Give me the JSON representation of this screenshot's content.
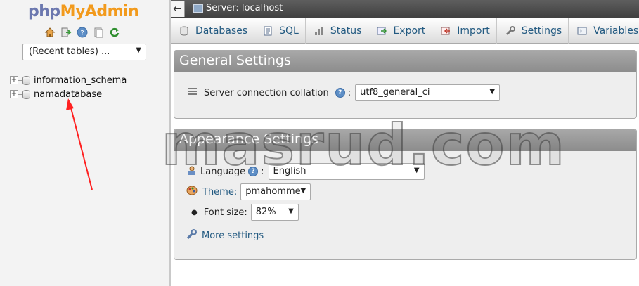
{
  "nav": {
    "logo_part1": "php",
    "logo_part2": "MyAdmin",
    "quick_icons": [
      "home-icon",
      "logout-icon",
      "help-icon",
      "documentation-icon",
      "reload-icon"
    ],
    "recent_tables": "(Recent tables) ...",
    "databases": [
      {
        "name": "information_schema",
        "expander": "+"
      },
      {
        "name": "namadatabase",
        "expander": "+"
      }
    ]
  },
  "topbar": {
    "back": "←",
    "title": "Server: localhost"
  },
  "tabs": [
    {
      "label": "Databases",
      "icon": "database-icon"
    },
    {
      "label": "SQL",
      "icon": "sql-icon"
    },
    {
      "label": "Status",
      "icon": "status-icon"
    },
    {
      "label": "Export",
      "icon": "export-icon"
    },
    {
      "label": "Import",
      "icon": "import-icon"
    },
    {
      "label": "Settings",
      "icon": "wrench-icon"
    },
    {
      "label": "Variables",
      "icon": "variables-icon"
    }
  ],
  "general": {
    "legend": "General Settings",
    "collation_label": "Server connection collation",
    "colon": ":",
    "collation_value": "utf8_general_ci"
  },
  "appearance": {
    "legend": "Appearance Settings",
    "language_label": "Language",
    "language_value": "English",
    "theme_label": "Theme:",
    "theme_value": "pmahomme",
    "fontsize_label": "Font size:",
    "fontsize_value": "82%",
    "more_settings": "More settings"
  },
  "watermark": "masrud.com",
  "colors": {
    "accent_link": "#235a81",
    "logo_php": "#6c78af",
    "logo_myadmin": "#f29a1c",
    "arrow": "#ff2020"
  }
}
